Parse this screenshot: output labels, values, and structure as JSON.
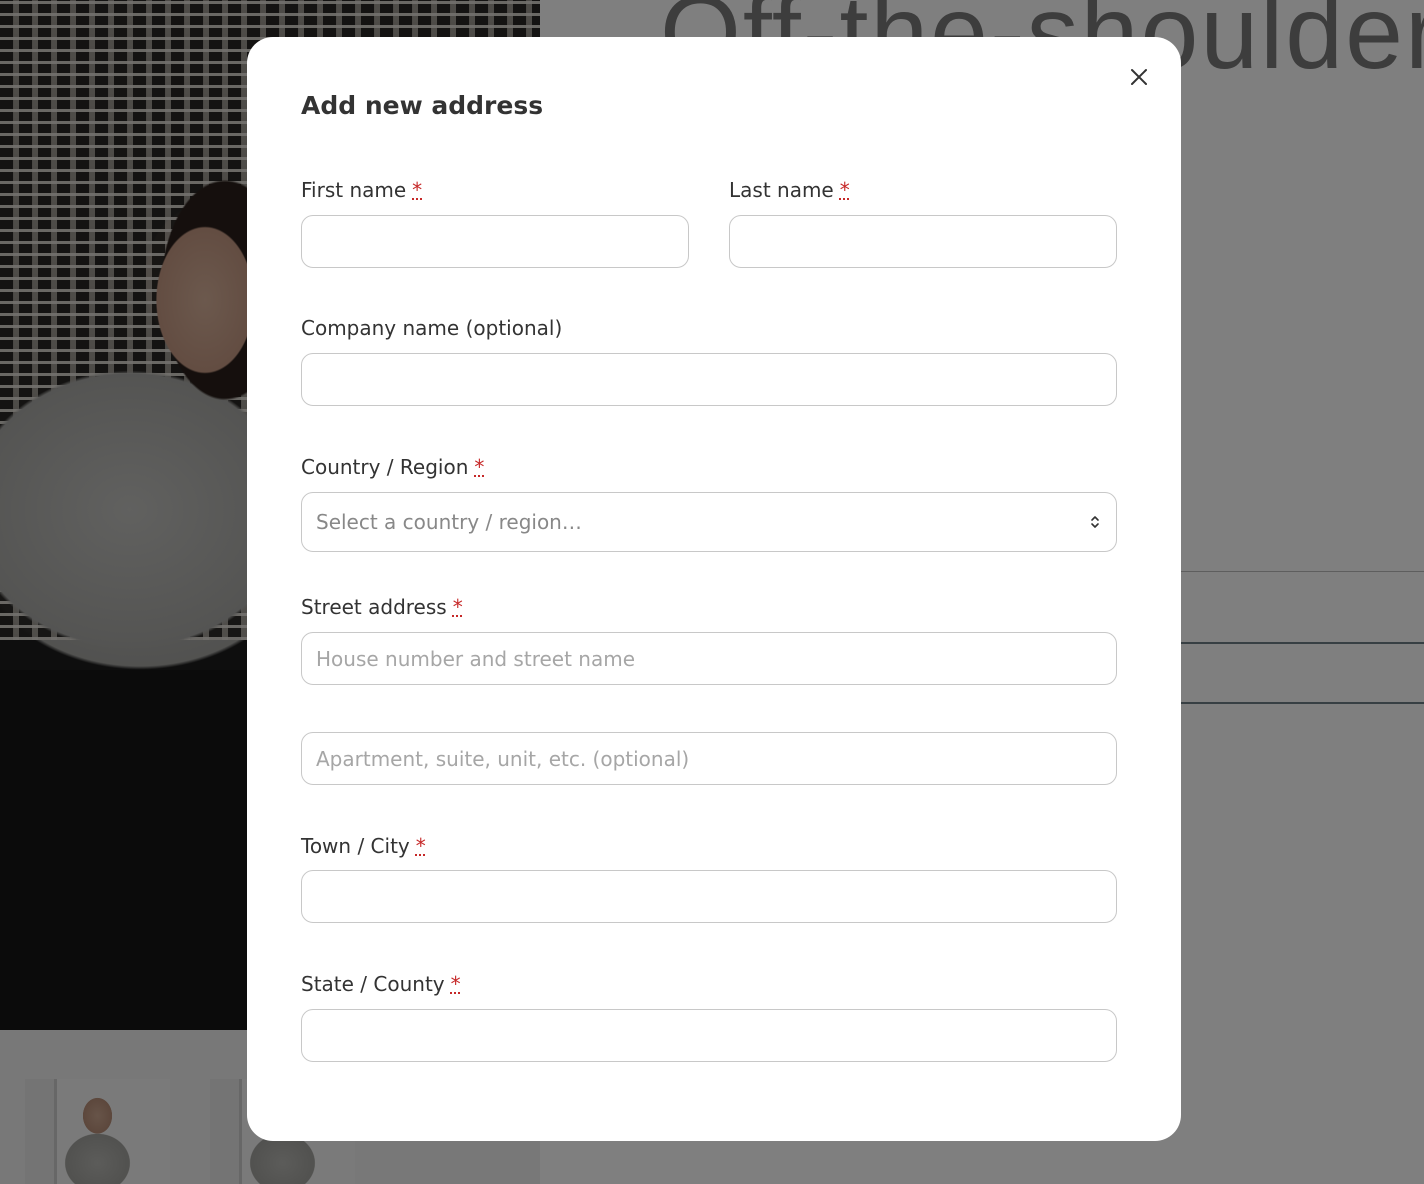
{
  "background": {
    "product_title": "Off-the-shoulder"
  },
  "modal": {
    "title": "Add new address",
    "required_mark": "*",
    "fields": {
      "first_name": {
        "label": "First name",
        "value": ""
      },
      "last_name": {
        "label": "Last name",
        "value": ""
      },
      "company": {
        "label": "Company name (optional)",
        "value": ""
      },
      "country": {
        "label": "Country / Region",
        "selected": "Select a country / region…"
      },
      "street": {
        "label": "Street address",
        "placeholder": "House number and street name",
        "value": ""
      },
      "street2": {
        "placeholder": "Apartment, suite, unit, etc. (optional)",
        "value": ""
      },
      "city": {
        "label": "Town / City",
        "value": ""
      },
      "state": {
        "label": "State / County",
        "value": ""
      }
    },
    "icons": {
      "close": "close-icon",
      "select": "chevron-up-down-icon"
    }
  }
}
